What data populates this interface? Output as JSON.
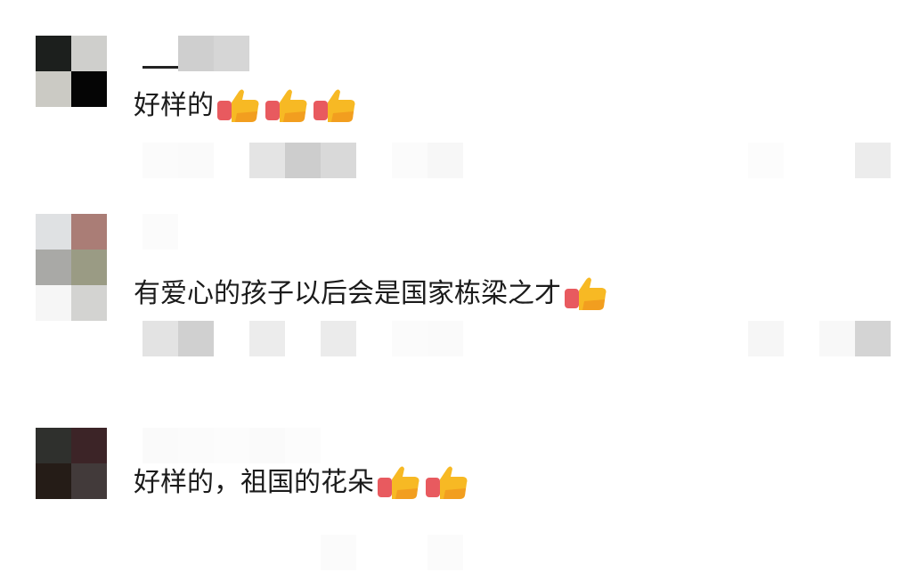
{
  "comments": [
    {
      "text": "好样的",
      "thumbs": [
        "thumbs-up-icon",
        "thumbs-up-icon",
        "thumbs-up-icon"
      ],
      "avatar_colors": [
        "#1c1f1d",
        "#cfcfcc",
        "#cbcac4",
        "#050505"
      ]
    },
    {
      "text": "有爱心的孩子以后会是国家栋梁之才",
      "thumbs": [
        "thumbs-up-icon"
      ],
      "avatar_colors": [
        "#dfe1e3",
        "#aa7d76",
        "#a9a9a6",
        "#9a9b84"
      ]
    },
    {
      "text": "好样的，祖国的花朵",
      "thumbs": [
        "thumbs-up-icon",
        "thumbs-up-icon"
      ],
      "avatar_colors": [
        "#2f302d",
        "#3c2427",
        "#251c17",
        "#423a3a"
      ]
    }
  ],
  "colors": {
    "text": "#1b1b1b",
    "background": "#ffffff",
    "thumb_yellow": "#f7b924",
    "thumb_orange": "#ef8c1c",
    "cuff_red": "#e85a5f"
  }
}
